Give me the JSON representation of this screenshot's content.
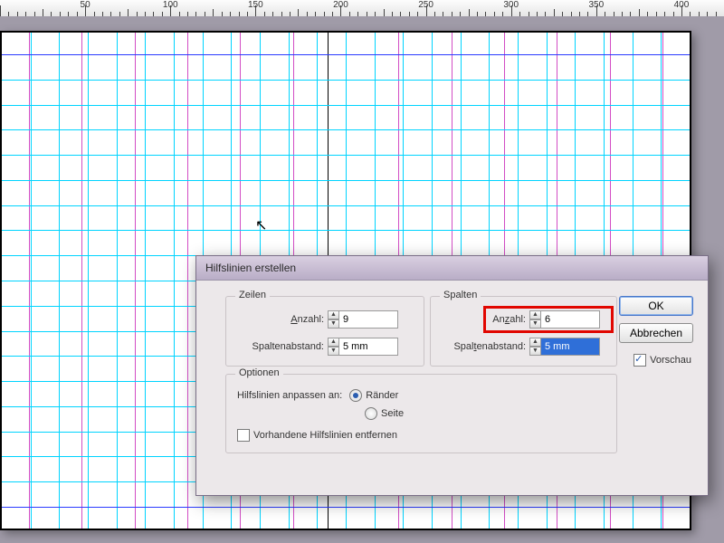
{
  "ruler": {
    "labels": [
      50,
      100,
      150,
      200,
      250,
      300,
      350,
      400
    ]
  },
  "dialog": {
    "title": "Hilfslinien erstellen",
    "rows_group": "Zeilen",
    "cols_group": "Spalten",
    "opts_group": "Optionen",
    "count_label": "Anzahl:",
    "count_label_u": "Anzahl:",
    "gutter_label": "Spaltenabstand:",
    "gutter_label_u": "Spaltenabstand:",
    "rows_count": "9",
    "rows_gutter": "5 mm",
    "cols_count": "6",
    "cols_gutter": "5 mm",
    "fit_label": "Hilfslinien anpassen an:",
    "fit_margins": "Ränder",
    "fit_page": "Seite",
    "remove_existing": "Vorhandene Hilfslinien entfernen",
    "ok": "OK",
    "cancel": "Abbrechen",
    "preview": "Vorschau"
  }
}
